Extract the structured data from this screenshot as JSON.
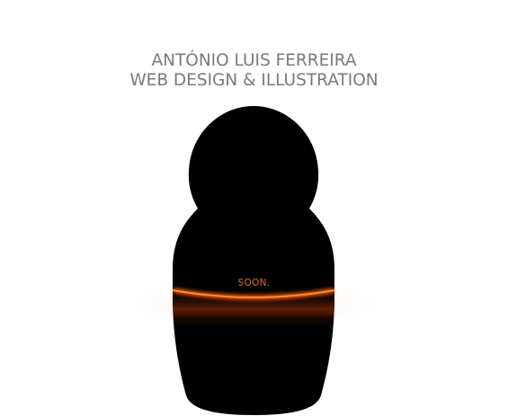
{
  "header": {
    "name": "ANTÓNIO LUIS FERREIRA",
    "tagline": "WEB DESIGN & ILLUSTRATION"
  },
  "doll": {
    "status_text": "SOON.",
    "body_color": "#000000",
    "glow_color": "#ff6a10"
  }
}
